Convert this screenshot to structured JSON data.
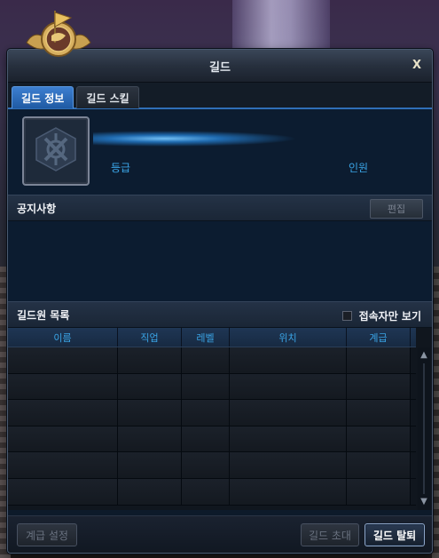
{
  "window": {
    "title": "길드",
    "close_label": "X"
  },
  "tabs": [
    {
      "label": "길드 정보",
      "active": true
    },
    {
      "label": "길드 스킬",
      "active": false
    }
  ],
  "info": {
    "grade_label": "등급",
    "members_label": "인원"
  },
  "notice": {
    "title": "공지사항",
    "edit_label": "편집"
  },
  "member_list": {
    "title": "길드원 목록",
    "online_only_label": "접속자만 보기",
    "online_only_checked": false,
    "columns": [
      "이름",
      "직업",
      "레벨",
      "위치",
      "계급"
    ],
    "rows": [
      [
        "",
        "",
        "",
        "",
        ""
      ],
      [
        "",
        "",
        "",
        "",
        ""
      ],
      [
        "",
        "",
        "",
        "",
        ""
      ],
      [
        "",
        "",
        "",
        "",
        ""
      ],
      [
        "",
        "",
        "",
        "",
        ""
      ],
      [
        "",
        "",
        "",
        "",
        ""
      ]
    ]
  },
  "buttons": {
    "grade_settings": "계급 설정",
    "invite": "길드 초대",
    "leave": "길드 탈퇴"
  },
  "colors": {
    "accent_blue": "#3aa4e6",
    "tab_active": "#2f6fb8",
    "panel_bg": "#0c1c30"
  },
  "icons": {
    "emblem": "guild-banner-emblem",
    "guild_mark": "guild-crest-icon"
  }
}
